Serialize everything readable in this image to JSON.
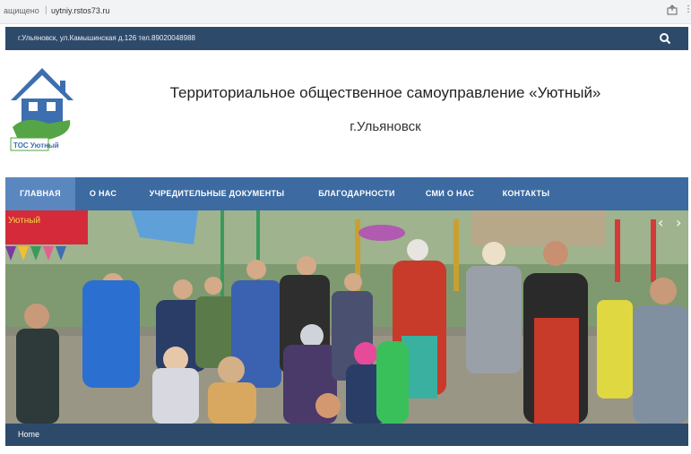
{
  "browser": {
    "status_text": "ащищено",
    "url": "uytniy.rstos73.ru",
    "more_glyph": "⋮"
  },
  "topbar": {
    "address": "г.Ульяновск, ул.Камышинская д.126 тел.89020048988",
    "search_icon": "search-icon"
  },
  "header": {
    "logo_text": "ТОС Уютный",
    "title": "Территориальное общественное самоуправление «Уютный»",
    "city": "г.Ульяновск"
  },
  "nav": {
    "items": [
      {
        "label": "ГЛАВНАЯ",
        "active": true
      },
      {
        "label": "О НАС",
        "active": false
      },
      {
        "label": "УЧРЕДИТЕЛЬНЫЕ ДОКУМЕНТЫ",
        "active": false
      },
      {
        "label": "БЛАГОДАРНОСТИ",
        "active": false
      },
      {
        "label": "СМИ О НАС",
        "active": false
      },
      {
        "label": "КОНТАКТЫ",
        "active": false
      }
    ]
  },
  "slider": {
    "prev_label": "‹",
    "next_label": "›",
    "banner_text": "Уютный"
  },
  "breadcrumb": {
    "home": "Home"
  },
  "colors": {
    "topbar": "#2e4a6b",
    "nav": "#3c6aa1",
    "nav_active": "#5b87bf"
  }
}
